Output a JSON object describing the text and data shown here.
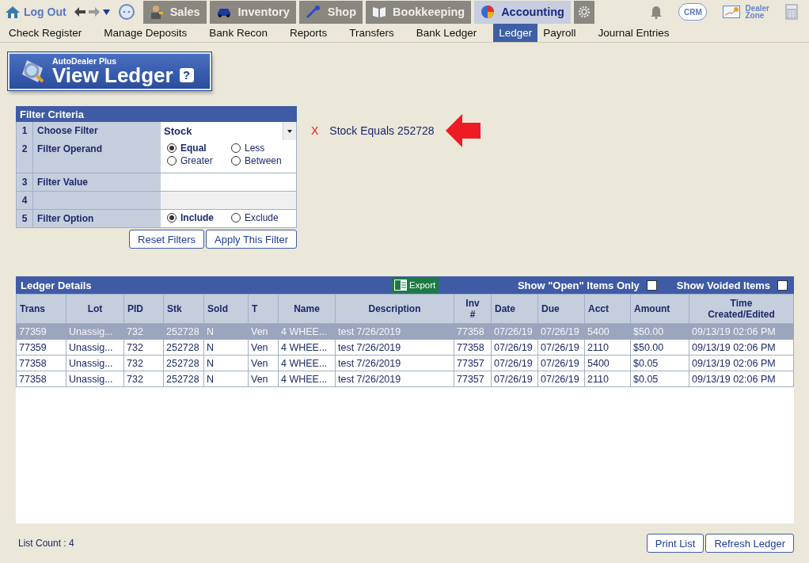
{
  "top_nav": {
    "logout": "Log Out",
    "modules": [
      {
        "label": "Sales",
        "kind": "sales",
        "selected": false
      },
      {
        "label": "Inventory",
        "kind": "inventory",
        "selected": false
      },
      {
        "label": "Shop",
        "kind": "shop",
        "selected": false
      },
      {
        "label": "Bookkeeping",
        "kind": "book",
        "selected": false
      },
      {
        "label": "Accounting",
        "kind": "accounting",
        "selected": true
      }
    ],
    "crm": "CRM",
    "dealer_zone": [
      "Dealer",
      "Zone"
    ]
  },
  "sub_nav": [
    {
      "label": "Check Register",
      "selected": false
    },
    {
      "label": "Manage Deposits",
      "selected": false
    },
    {
      "label": "Bank Recon",
      "selected": false
    },
    {
      "label": "Reports",
      "selected": false
    },
    {
      "label": "Transfers",
      "selected": false
    },
    {
      "label": "Bank Ledger",
      "selected": false
    },
    {
      "label": "Ledger",
      "selected": true
    },
    {
      "label": "Payroll",
      "selected": false
    },
    {
      "label": "Journal Entries",
      "selected": false
    }
  ],
  "banner": {
    "brand": "AutoDealer Plus",
    "title": "View Ledger",
    "help": "?"
  },
  "filter": {
    "title": "Filter Criteria",
    "rows": [
      {
        "num": "1",
        "label": "Choose Filter",
        "kind": "select",
        "value": "Stock"
      },
      {
        "num": "2",
        "label": "Filter Operand",
        "kind": "radio",
        "options": [
          {
            "label": "Equal",
            "selected": true
          },
          {
            "label": "Less",
            "selected": false
          },
          {
            "label": "Greater",
            "selected": false
          },
          {
            "label": "Between",
            "selected": false
          }
        ]
      },
      {
        "num": "3",
        "label": "Filter Value",
        "kind": "input"
      },
      {
        "num": "4",
        "kind": "blank"
      },
      {
        "num": "5",
        "label": "Filter Option",
        "kind": "radio",
        "options": [
          {
            "label": "Include",
            "selected": true
          },
          {
            "label": "Exclude",
            "selected": false
          }
        ]
      }
    ],
    "buttons": [
      "Reset Filters",
      "Apply This Filter"
    ]
  },
  "active_filter": {
    "remove": "X",
    "text": "Stock Equals 252728"
  },
  "ledger": {
    "title": "Ledger Details",
    "export": "Export",
    "toggles": [
      {
        "label": "Show \"Open\" Items Only",
        "checked": false
      },
      {
        "label": "Show Voided Items",
        "checked": false
      }
    ],
    "columns": [
      "Trans",
      "Lot",
      "PID",
      "Stk",
      "Sold",
      "T",
      "Name",
      "Description",
      "Inv #",
      "Date",
      "Due",
      "Acct",
      "Amount",
      "Time Created/Edited"
    ],
    "rows": [
      {
        "selected": true,
        "cells": [
          "77359",
          "Unassig...",
          "732",
          "252728",
          "N",
          "Ven",
          "4 WHEE...",
          "test 7/26/2019",
          "77358",
          "07/26/19",
          "07/26/19",
          "5400",
          "$50.00",
          "09/13/19 02:06 PM"
        ]
      },
      {
        "selected": false,
        "cells": [
          "77359",
          "Unassig...",
          "732",
          "252728",
          "N",
          "Ven",
          "4 WHEE...",
          "test 7/26/2019",
          "77358",
          "07/26/19",
          "07/26/19",
          "2110",
          "$50.00",
          "09/13/19 02:06 PM"
        ]
      },
      {
        "selected": false,
        "cells": [
          "77358",
          "Unassig...",
          "732",
          "252728",
          "N",
          "Ven",
          "4 WHEE...",
          "test 7/26/2019",
          "77357",
          "07/26/19",
          "07/26/19",
          "5400",
          "$0.05",
          "09/13/19 02:06 PM"
        ]
      },
      {
        "selected": false,
        "cells": [
          "77358",
          "Unassig...",
          "732",
          "252728",
          "N",
          "Ven",
          "4 WHEE...",
          "test 7/26/2019",
          "77357",
          "07/26/19",
          "07/26/19",
          "2110",
          "$0.05",
          "09/13/19 02:06 PM"
        ]
      }
    ]
  },
  "list_count": "List Count : 4",
  "buttons": [
    "Print List",
    "Refresh Ledger"
  ]
}
